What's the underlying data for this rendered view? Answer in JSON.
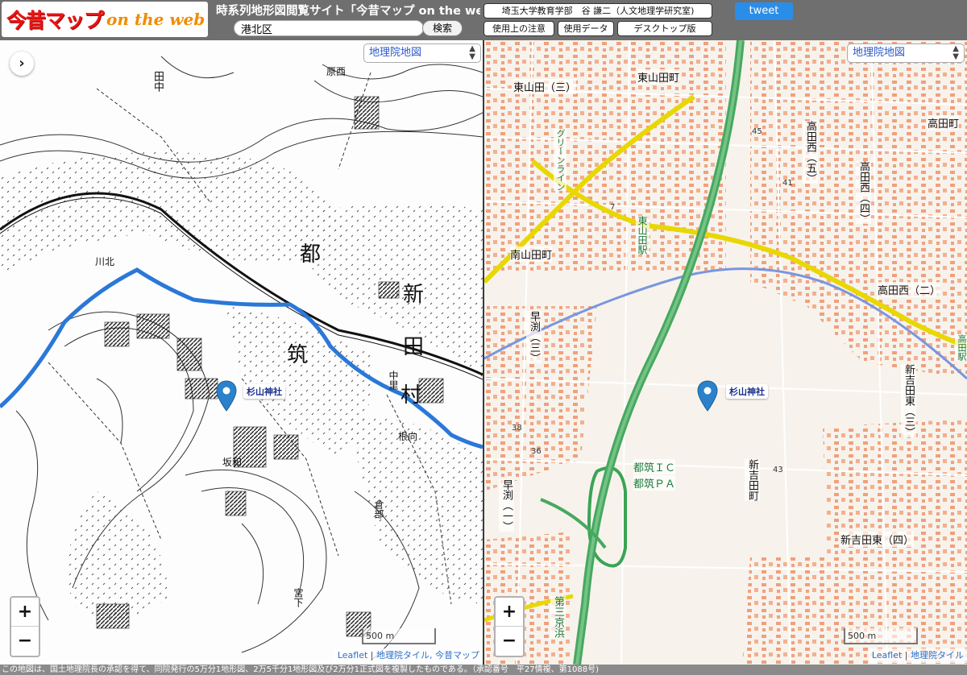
{
  "header": {
    "logo_main": "今昔マップ",
    "logo_sub": "on the web",
    "site_title": "時系列地形図閲覧サイト「今昔マップ on the web",
    "search_value": "港北区",
    "search_button": "検索",
    "author": "埼玉大学教育学部　谷 謙二（人文地理学研究室)",
    "btn_notes": "使用上の注意",
    "btn_data": "使用データ",
    "btn_desktop": "デスクトップ版",
    "tweet": "tweet"
  },
  "left_map": {
    "layer": "地理院地図",
    "marker_label": "杉山神社",
    "scale": "500 m",
    "attribution": {
      "leaflet": "Leaflet",
      "tiles": "地理院タイル, 今昔マップ"
    },
    "place_labels": [
      {
        "text": "都",
        "name": "place-label-to"
      },
      {
        "text": "筑",
        "name": "place-label-chiku"
      },
      {
        "text": "新",
        "name": "place-label-shin"
      },
      {
        "text": "田",
        "name": "place-label-ta"
      },
      {
        "text": "村",
        "name": "place-label-mura"
      },
      {
        "text": "川北",
        "name": "place-label-kawakita"
      },
      {
        "text": "坂和",
        "name": "place-label-sakawa"
      },
      {
        "text": "根向",
        "name": "place-label-nemukai"
      },
      {
        "text": "倉部",
        "name": "place-label-kurabe"
      },
      {
        "text": "宮下",
        "name": "place-label-miyashita"
      },
      {
        "text": "中里",
        "name": "place-label-nakazato"
      },
      {
        "text": "田中",
        "name": "place-label-tanaka"
      },
      {
        "text": "原西",
        "name": "place-label-harunishi"
      }
    ]
  },
  "right_map": {
    "layer": "地理院地図",
    "marker_label": "杉山神社",
    "scale": "500 m",
    "attribution": {
      "leaflet": "Leaflet",
      "tiles": "地理院タイル"
    },
    "place_labels": [
      {
        "text": "東山田（三）",
        "name": "place-label-higashiyamata-3"
      },
      {
        "text": "東山田町",
        "name": "place-label-higashiyamata-cho"
      },
      {
        "text": "高田町",
        "name": "place-label-takata-cho"
      },
      {
        "text": "高田西（五）",
        "name": "place-label-takatanishi-5"
      },
      {
        "text": "高田西（四）",
        "name": "place-label-takatanishi-4"
      },
      {
        "text": "高田西（二）",
        "name": "place-label-takatanishi-2"
      },
      {
        "text": "東山田駅",
        "name": "place-label-higashiyamata-station"
      },
      {
        "text": "南山田町",
        "name": "place-label-minamiyamata-cho"
      },
      {
        "text": "早渕（三）",
        "name": "place-label-hayabuchi-3"
      },
      {
        "text": "早渕（一）",
        "name": "place-label-hayabuchi-1"
      },
      {
        "text": "新吉田東（三）",
        "name": "place-label-shinyoshidahigashi-3"
      },
      {
        "text": "新吉田町",
        "name": "place-label-shinyoshida-cho"
      },
      {
        "text": "新吉田東（四）",
        "name": "place-label-shinyoshidahigashi-4"
      },
      {
        "text": "都筑ＩＣ",
        "name": "place-label-tsuzuki-ic"
      },
      {
        "text": "都筑ＰＡ",
        "name": "place-label-tsuzuki-pa"
      },
      {
        "text": "第三京浜",
        "name": "place-label-daisan-keihin"
      },
      {
        "text": "高田駅",
        "name": "place-label-takata-station"
      },
      {
        "text": "グリーンライン",
        "name": "place-label-green-line"
      }
    ],
    "elevations": [
      "45",
      "41",
      "43",
      "36",
      "38",
      "7"
    ]
  },
  "footer": "この地図は、国土地理院長の承認を得て、同院発行の5万分1地形図、2万5千分1地形図及び2万分1正式図を複製したものである。（承認番号　平27情複、第1088号)"
}
